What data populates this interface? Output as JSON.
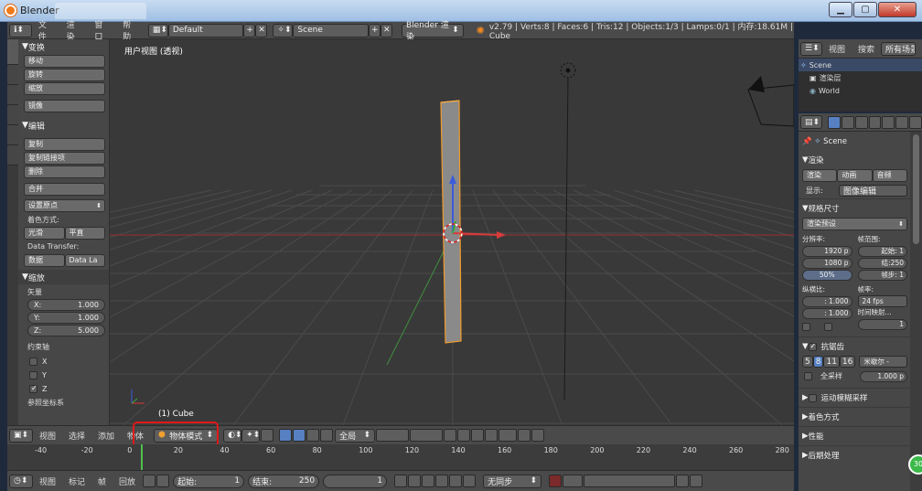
{
  "window": {
    "title": "Blender"
  },
  "infobar": {
    "menus": [
      "文件",
      "渲染",
      "窗口",
      "帮助"
    ],
    "screen_layout": "Default",
    "scene": "Scene",
    "engine": "Blender 渲染",
    "stats": "v2.79 | Verts:8 | Faces:6 | Tris:12 | Objects:1/3 | Lamps:0/1 | 内存:18.61M | Cube"
  },
  "left_tabs": [
    "工具",
    "创建",
    "关系",
    "动画",
    "物理",
    "蜡笔"
  ],
  "toolshelf": {
    "transform": {
      "title": "变换",
      "buttons": [
        "移动",
        "旋转",
        "缩放",
        "镜像"
      ]
    },
    "edit": {
      "title": "编辑",
      "buttons": [
        "复制",
        "复制链接项",
        "删除",
        "合并"
      ],
      "set_origin": "设置原点",
      "shading_label": "着色方式:",
      "smooth": "光滑",
      "flat": "平直",
      "data_transfer_label": "Data Transfer:",
      "data": "数据",
      "data_layers": "Data La"
    },
    "resize": {
      "title": "缩放",
      "vector_label": "矢量",
      "x_label": "X:",
      "x": "1.000",
      "y_label": "Y:",
      "y": "1.000",
      "z_label": "Z:",
      "z": "5.000",
      "constraint_label": "约束轴",
      "axes": [
        "X",
        "Y",
        "Z"
      ],
      "axes_checked": [
        false,
        false,
        true
      ],
      "orientation_label": "参照坐标系"
    }
  },
  "viewport": {
    "title": "用户视图 (透视)",
    "object_label": "(1) Cube"
  },
  "view3d_header": {
    "menus": [
      "视图",
      "选择",
      "添加",
      "物体"
    ],
    "mode": "物体模式",
    "pivot": "全局"
  },
  "timeline": {
    "ticks": [
      "-40",
      "-20",
      "0",
      "20",
      "40",
      "60",
      "80",
      "100",
      "120",
      "140",
      "160",
      "180",
      "200",
      "220",
      "240",
      "260",
      "280"
    ]
  },
  "timeline_header": {
    "menus": [
      "视图",
      "标记",
      "帧",
      "回放"
    ],
    "start_label": "起始:",
    "start": "1",
    "end_label": "结束:",
    "end": "250",
    "current": "1",
    "sync": "无同步"
  },
  "outliner": {
    "menus": [
      "视图",
      "搜索"
    ],
    "filter": "所有场景",
    "items": [
      "Scene",
      "渲染层",
      "World"
    ]
  },
  "properties": {
    "scene": "Scene",
    "render": {
      "title": "渲染",
      "render_btn": "渲染",
      "anim_btn": "动画",
      "audio_btn": "音频",
      "display_label": "显示:",
      "display": "图像编辑"
    },
    "dimensions": {
      "title": "规格尺寸",
      "preset": "渲染预设",
      "resolution_label": "分辨率:",
      "res_x": "1920 p",
      "res_y": "1080 p",
      "percent": "50%",
      "frame_range_label": "帧范围:",
      "start": "起始: 1",
      "end": "结:250",
      "step": "帧步: 1",
      "aspect_label": "纵横比:",
      "aspect_x": ": 1.000",
      "aspect_y": ": 1.000",
      "fps_label": "帧率:",
      "fps": "24 fps",
      "time_remap_label": "时间映射...",
      "remap_value": "1"
    },
    "antialiasing": {
      "title": "抗锯齿",
      "samples": [
        "5",
        "8",
        "11",
        "16"
      ],
      "filter": "米歇尔 -",
      "full_sample": "全采样",
      "filter_size": "1.000 p"
    },
    "collapsed": [
      "运动模糊采样",
      "着色方式",
      "性能",
      "后期处理"
    ]
  },
  "badge": "30"
}
